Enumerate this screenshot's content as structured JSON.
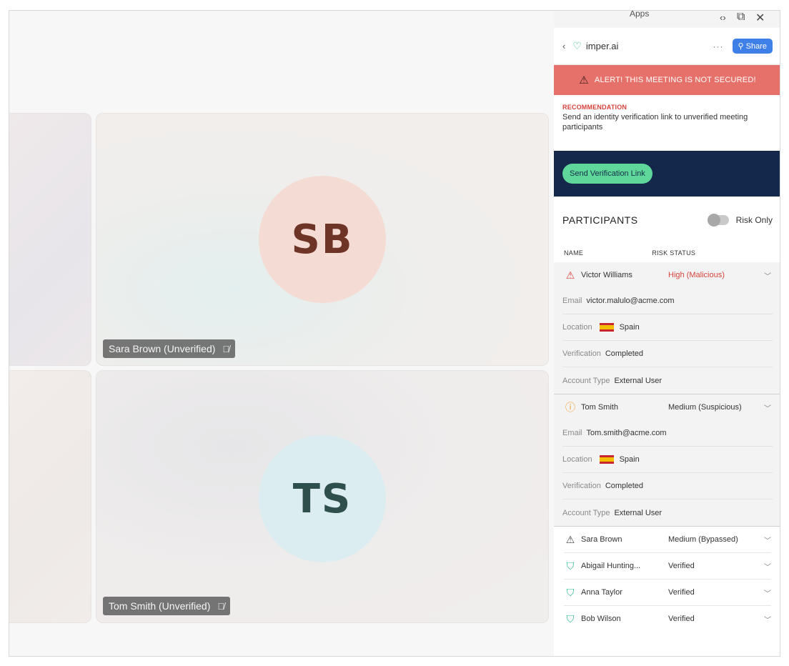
{
  "panel": {
    "apps_title": "Apps",
    "controls": {
      "code": "‹›",
      "popout": "⧉",
      "close": "✕"
    },
    "header": {
      "back": "‹",
      "app_name": "imper.ai",
      "more": "···",
      "share_label": "Share"
    },
    "alert": "ALERT! THIS MEETING IS NOT SECURED!",
    "recommendation_label": "RECOMMENDATION",
    "recommendation_text": "Send an identity verification link to unverified meeting participants",
    "verify_button": "Send Verification Link",
    "participants_title": "PARTICIPANTS",
    "risk_only_label": "Risk Only",
    "risk_only_on": false,
    "columns": {
      "name": "NAME",
      "status": "RISK STATUS"
    },
    "labels": {
      "email": "Email",
      "location": "Location",
      "verification": "Verification",
      "account_type": "Account Type"
    },
    "participants": [
      {
        "name": "Victor Williams",
        "status": "High (Malicious)",
        "icon": "red-warning-icon",
        "email": "victor.malulo@acme.com",
        "location": "Spain",
        "verification": "Completed",
        "account_type": "External User"
      },
      {
        "name": "Tom Smith",
        "status": "Medium (Suspicious)",
        "icon": "orange-alert-icon",
        "email": "Tom.smith@acme.com",
        "location": "Spain",
        "verification": "Completed",
        "account_type": "External User"
      },
      {
        "name": "Sara Brown",
        "status": "Medium (Bypassed)",
        "icon": "warning-outline-icon"
      },
      {
        "name": "Abigail Hunting...",
        "status": "Verified",
        "icon": "verified-shield-icon"
      },
      {
        "name": "Anna Taylor",
        "status": "Verified",
        "icon": "verified-shield-icon"
      },
      {
        "name": "Bob Wilson",
        "status": "Verified",
        "icon": "verified-shield-icon"
      }
    ]
  },
  "tiles": {
    "sb": {
      "initials": "SB",
      "name_tag": "Sara Brown (Unverified)"
    },
    "ts": {
      "initials": "TS",
      "name_tag": "Tom Smith (Unverified)"
    }
  },
  "colors": {
    "alert": "#e5716a",
    "navy": "#13284a",
    "verify": "#5fd69a",
    "share": "#3f7fe8",
    "risk_red": "#d7433b"
  }
}
